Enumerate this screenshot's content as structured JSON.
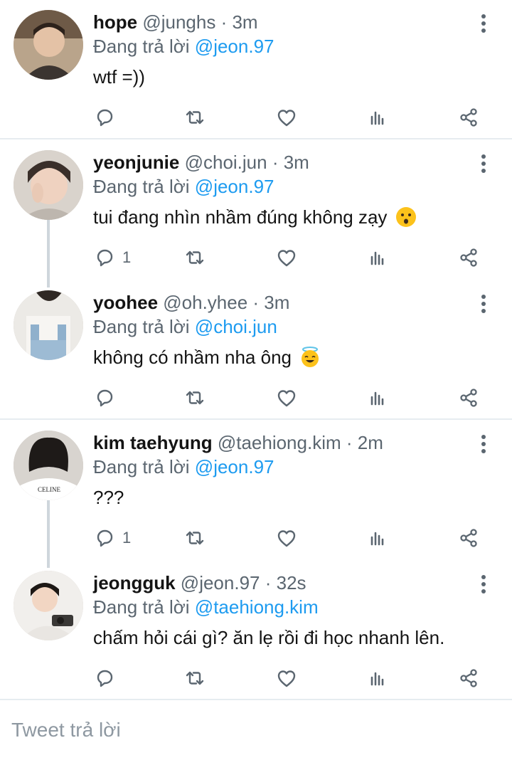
{
  "reply_prefix": "Đang trả lời",
  "tweets": [
    {
      "name": "hope",
      "handle": "@junghs",
      "time": "· 3m",
      "reply_to": "@jeon.97",
      "text": "wtf =))",
      "reply_count": ""
    },
    {
      "name": "yeonjunie",
      "handle": "@choi.jun",
      "time": "· 3m",
      "reply_to": "@jeon.97",
      "text": "tui đang nhìn nhầm đúng không zạy",
      "reply_count": "1"
    },
    {
      "name": "yoohee",
      "handle": "@oh.yhee",
      "time": "· 3m",
      "reply_to": "@choi.jun",
      "text": "không có nhầm nha ông",
      "reply_count": ""
    },
    {
      "name": "kim taehyung",
      "handle": "@taehiong.kim",
      "time": "· 2m",
      "reply_to": "@jeon.97",
      "text": "???",
      "reply_count": "1"
    },
    {
      "name": "jeongguk",
      "handle": "@jeon.97",
      "time": "· 32s",
      "reply_to": "@taehiong.kim",
      "text": "chấm hỏi cái gì? ăn lẹ rồi đi học nhanh lên.",
      "reply_count": ""
    }
  ],
  "composer": {
    "placeholder": "Tweet trả lời"
  },
  "icons": {
    "reply": "reply-icon",
    "retweet": "retweet-icon",
    "like": "heart-icon",
    "analytics": "analytics-icon",
    "share": "share-icon",
    "more": "more-vertical-icon"
  },
  "colors": {
    "mention": "#1d9bf0",
    "meta": "#5b6670",
    "icon": "#5b6670",
    "thread": "#cfd6dc"
  }
}
